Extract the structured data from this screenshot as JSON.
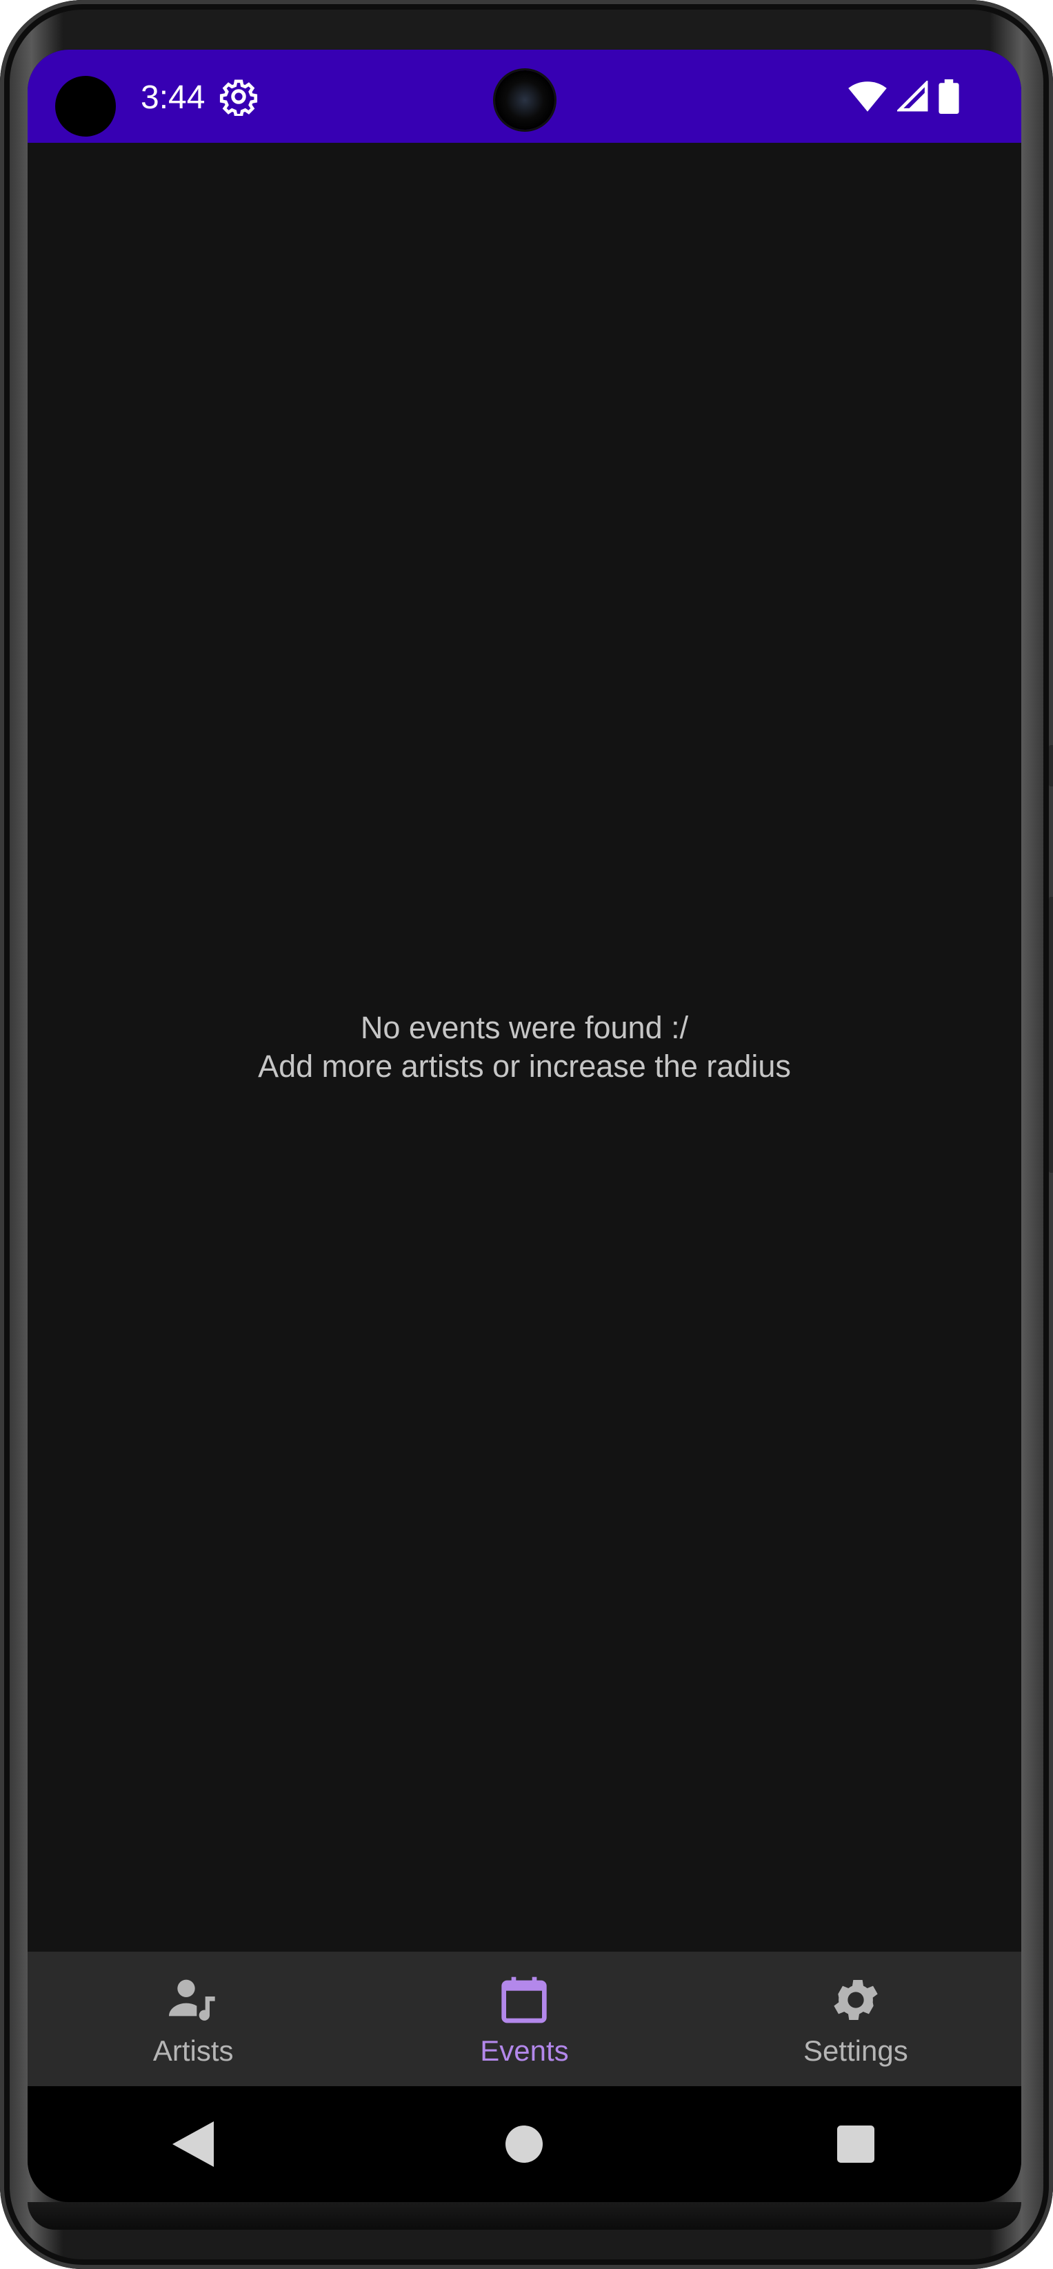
{
  "status_bar": {
    "time": "3:44",
    "icons": [
      "settings-gear-icon",
      "wifi-icon",
      "cellular-signal-icon",
      "battery-icon"
    ],
    "color": "#3700b3"
  },
  "main": {
    "empty_line1": "No events were found :/",
    "empty_line2": "Add more artists or increase the radius"
  },
  "bottom_nav": {
    "items": [
      {
        "label": "Artists",
        "icon": "artist-music-icon",
        "active": false
      },
      {
        "label": "Events",
        "icon": "calendar-icon",
        "active": true
      },
      {
        "label": "Settings",
        "icon": "gear-icon",
        "active": false
      }
    ],
    "active_color": "#b388eb",
    "inactive_color": "#b5b5b5"
  },
  "system_nav": {
    "buttons": [
      "back-icon",
      "home-icon",
      "recents-icon"
    ]
  }
}
